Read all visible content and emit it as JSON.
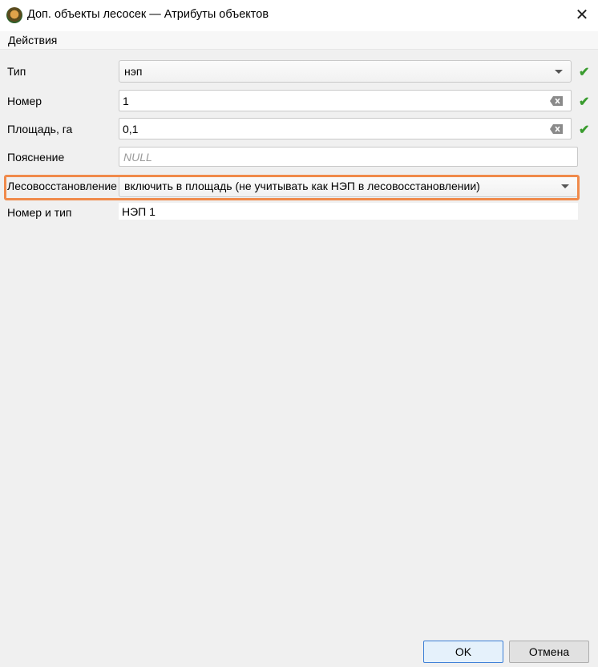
{
  "window": {
    "title": "Доп. объекты лесосек — Атрибуты объектов",
    "close_glyph": "✕"
  },
  "menu": {
    "actions": "Действия"
  },
  "fields": {
    "type": {
      "label": "Тип",
      "value": "нэп"
    },
    "number": {
      "label": "Номер",
      "value": "1"
    },
    "area": {
      "label": "Площадь, га",
      "value": "0,1"
    },
    "note": {
      "label": "Пояснение",
      "placeholder": "NULL"
    },
    "reforestation": {
      "label": "Лесовосстановление",
      "value": "включить в площадь (не учитывать как НЭП в лесовосстановлении)"
    },
    "number_type": {
      "label": "Номер и тип",
      "value": "НЭП 1"
    }
  },
  "check_glyph": "✔",
  "colors": {
    "check": "#3a9c2f",
    "highlight": "#f08a4b",
    "ok_border": "#3c7fd6"
  },
  "buttons": {
    "ok": "OK",
    "cancel": "Отмена"
  }
}
